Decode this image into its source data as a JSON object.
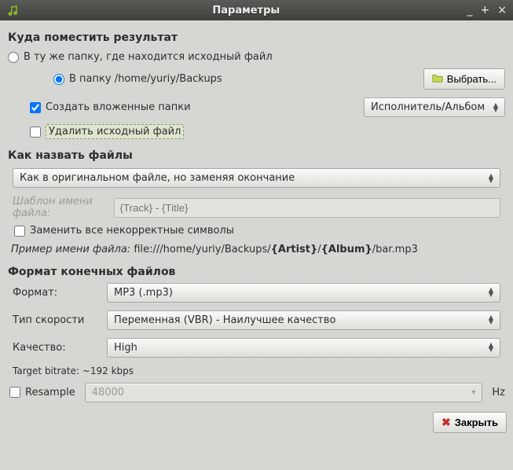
{
  "window": {
    "title": "Параметры",
    "min": "_",
    "max": "+",
    "close": "×"
  },
  "section1": {
    "title": "Куда поместить результат",
    "opt_same_folder": "В ту же папку, где находится исходный файл",
    "opt_folder_prefix": "В папку ",
    "opt_folder_path": "/home/yuriy/Backups",
    "choose_btn": "Выбрать...",
    "create_subfolders": "Создать вложенные папки",
    "subfolder_pattern": "Исполнитель/Альбом",
    "delete_original": "Удалить исходный файл"
  },
  "section2": {
    "title": "Как назвать файлы",
    "naming_mode": "Как в оригинальном файле, но заменяя окончание",
    "template_label": "Шаблон имени файла:",
    "template_placeholder": "{Track} - {Title}",
    "replace_bad_chars": "Заменить все некорректные символы",
    "example_prefix": "Пример имени файла: ",
    "example_plain": "file:///home/yuriy/Backups/",
    "example_artist": "{Artist}",
    "example_sep": "/",
    "example_album": "{Album}",
    "example_tail": "/bar.mp3"
  },
  "section3": {
    "title": "Формат конечных файлов",
    "format_label": "Формат:",
    "format_value": "MP3   (.mp3)",
    "rate_type_label": "Тип скорости",
    "rate_type_value": "Переменная (VBR) - Наилучшее качество",
    "quality_label": "Качество:",
    "quality_value": "High",
    "target_bitrate": "Target bitrate: ~192 kbps",
    "resample_label": "Resample",
    "resample_value": "48000",
    "hz": "Hz"
  },
  "footer": {
    "close": "Закрыть"
  }
}
